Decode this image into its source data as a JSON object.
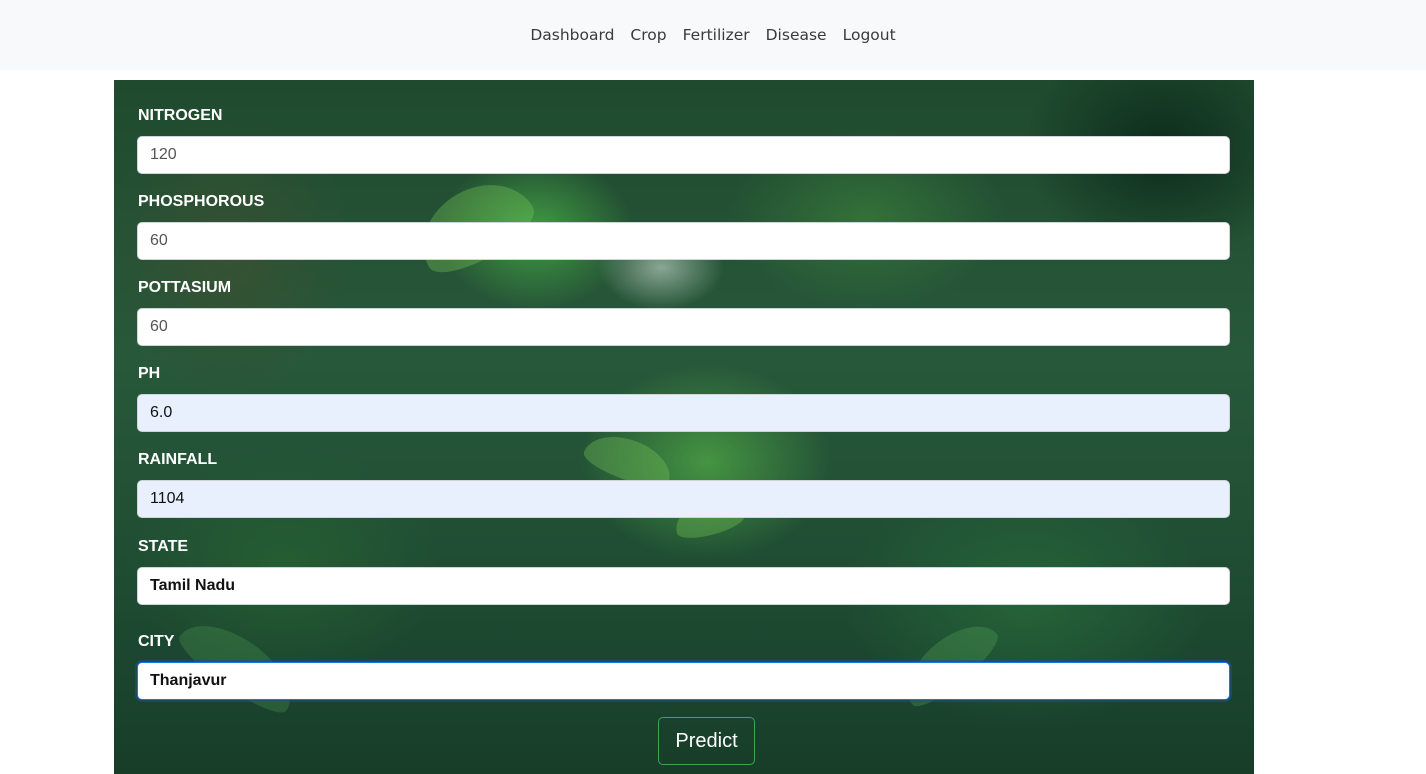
{
  "nav": {
    "items": [
      {
        "label": "Dashboard"
      },
      {
        "label": "Crop"
      },
      {
        "label": "Fertilizer"
      },
      {
        "label": "Disease"
      },
      {
        "label": "Logout"
      }
    ]
  },
  "form": {
    "nitrogen": {
      "label": "NITROGEN",
      "value": "120"
    },
    "phosphorous": {
      "label": "PHOSPHOROUS",
      "value": "60"
    },
    "pottasium": {
      "label": "POTTASIUM",
      "value": "60"
    },
    "ph": {
      "label": "PH",
      "value": "6.0"
    },
    "rainfall": {
      "label": "RAINFALL",
      "value": "1104"
    },
    "state": {
      "label": "STATE",
      "value": "Tamil Nadu"
    },
    "city": {
      "label": "CITY",
      "value": "Thanjavur"
    },
    "submit_label": "Predict"
  },
  "colors": {
    "navbar_bg": "#f8f9fa",
    "autofill_bg": "#e8f0fe",
    "button_border": "#3aa65a",
    "focus_border": "#1a73e8"
  }
}
